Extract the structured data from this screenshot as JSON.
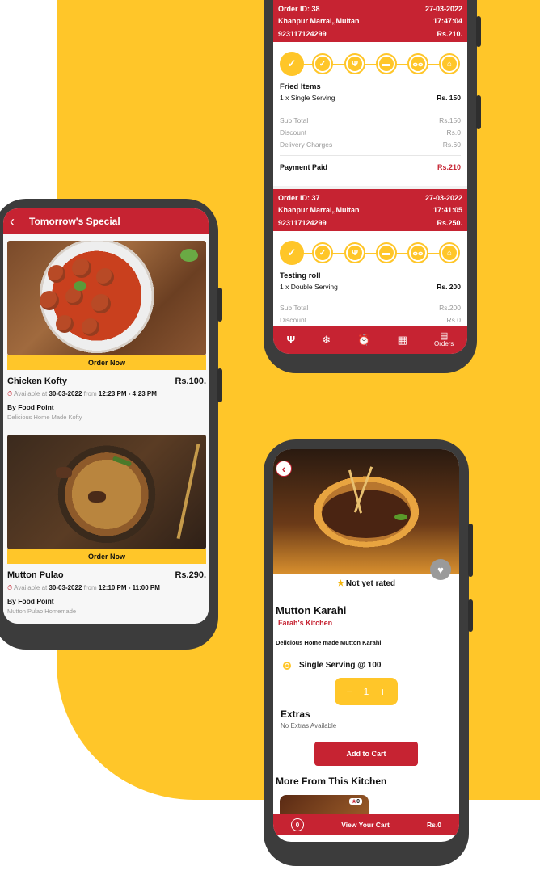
{
  "colors": {
    "brand_red": "#c62332",
    "brand_yellow": "#FFC629",
    "phone": "#3c3c3c"
  },
  "order_screen": {
    "orders": [
      {
        "id": "Order ID: 38",
        "date": "27-03-2022",
        "address": "Khanpur Marral,,Multan",
        "time": "17:47:04",
        "phone": "923117124299",
        "amount": "Rs.210.",
        "item_name": "Fried Items",
        "item_qty": "1 x Single Serving",
        "item_price": "Rs. 150",
        "subtotal_label": "Sub Total",
        "subtotal": "Rs.150",
        "discount_label": "Discount",
        "discount": "Rs.0",
        "delivery_label": "Delivery Charges",
        "delivery": "Rs.60",
        "paid_label": "Payment Paid",
        "paid": "Rs.210"
      },
      {
        "id": "Order ID: 37",
        "date": "27-03-2022",
        "address": "Khanpur Marral,,Multan",
        "time": "17:41:05",
        "phone": "923117124299",
        "amount": "Rs.250.",
        "item_name": "Testing roll",
        "item_qty": "1 x Double Serving",
        "item_price": "Rs. 200",
        "subtotal_label": "Sub Total",
        "subtotal": "Rs.200",
        "discount_label": "Discount",
        "discount": "Rs.0"
      }
    ],
    "tracker_icons": [
      "check-icon",
      "double-check-icon",
      "cutlery-icon",
      "box-icon",
      "bike-icon",
      "home-icon"
    ],
    "nav": [
      {
        "icon": "cutlery-icon"
      },
      {
        "icon": "snowflake-icon"
      },
      {
        "icon": "alarm-icon"
      },
      {
        "icon": "calendar-icon"
      },
      {
        "icon": "clipboard-icon",
        "label": "Orders"
      }
    ]
  },
  "special_screen": {
    "title": "Tomorrow's Special",
    "items": [
      {
        "order_label": "Order Now",
        "name": "Chicken Kofty",
        "price": "Rs.100.",
        "avail_prefix": "Available at",
        "date": "30-03-2022",
        "from_word": "from",
        "time": "12:23 PM - 4:23 PM",
        "by": "By Food Point",
        "desc": "Delicious Home Made Kofty"
      },
      {
        "order_label": "Order Now",
        "name": "Mutton Pulao",
        "price": "Rs.290.",
        "avail_prefix": "Available at",
        "date": "30-03-2022",
        "from_word": "from",
        "time": "12:10 PM - 11:00 PM",
        "by": "By Food Point",
        "desc": "Mutton Pulao Homemade"
      }
    ]
  },
  "detail_screen": {
    "rating": "Not yet rated",
    "name": "Mutton Karahi",
    "kitchen": "Farah's Kitchen",
    "description": "Delicious Home made Mutton Karahi",
    "serving": "Single Serving  @ 100",
    "qty": "1",
    "minus": "−",
    "plus": "+",
    "extras_title": "Extras",
    "extras_text": "No Extras Available",
    "add_to_cart": "Add to Cart",
    "more_title": "More From This Kitchen",
    "mini_rating": "0",
    "cart_count": "0",
    "view_cart": "View Your Cart",
    "cart_total": "Rs.0"
  }
}
